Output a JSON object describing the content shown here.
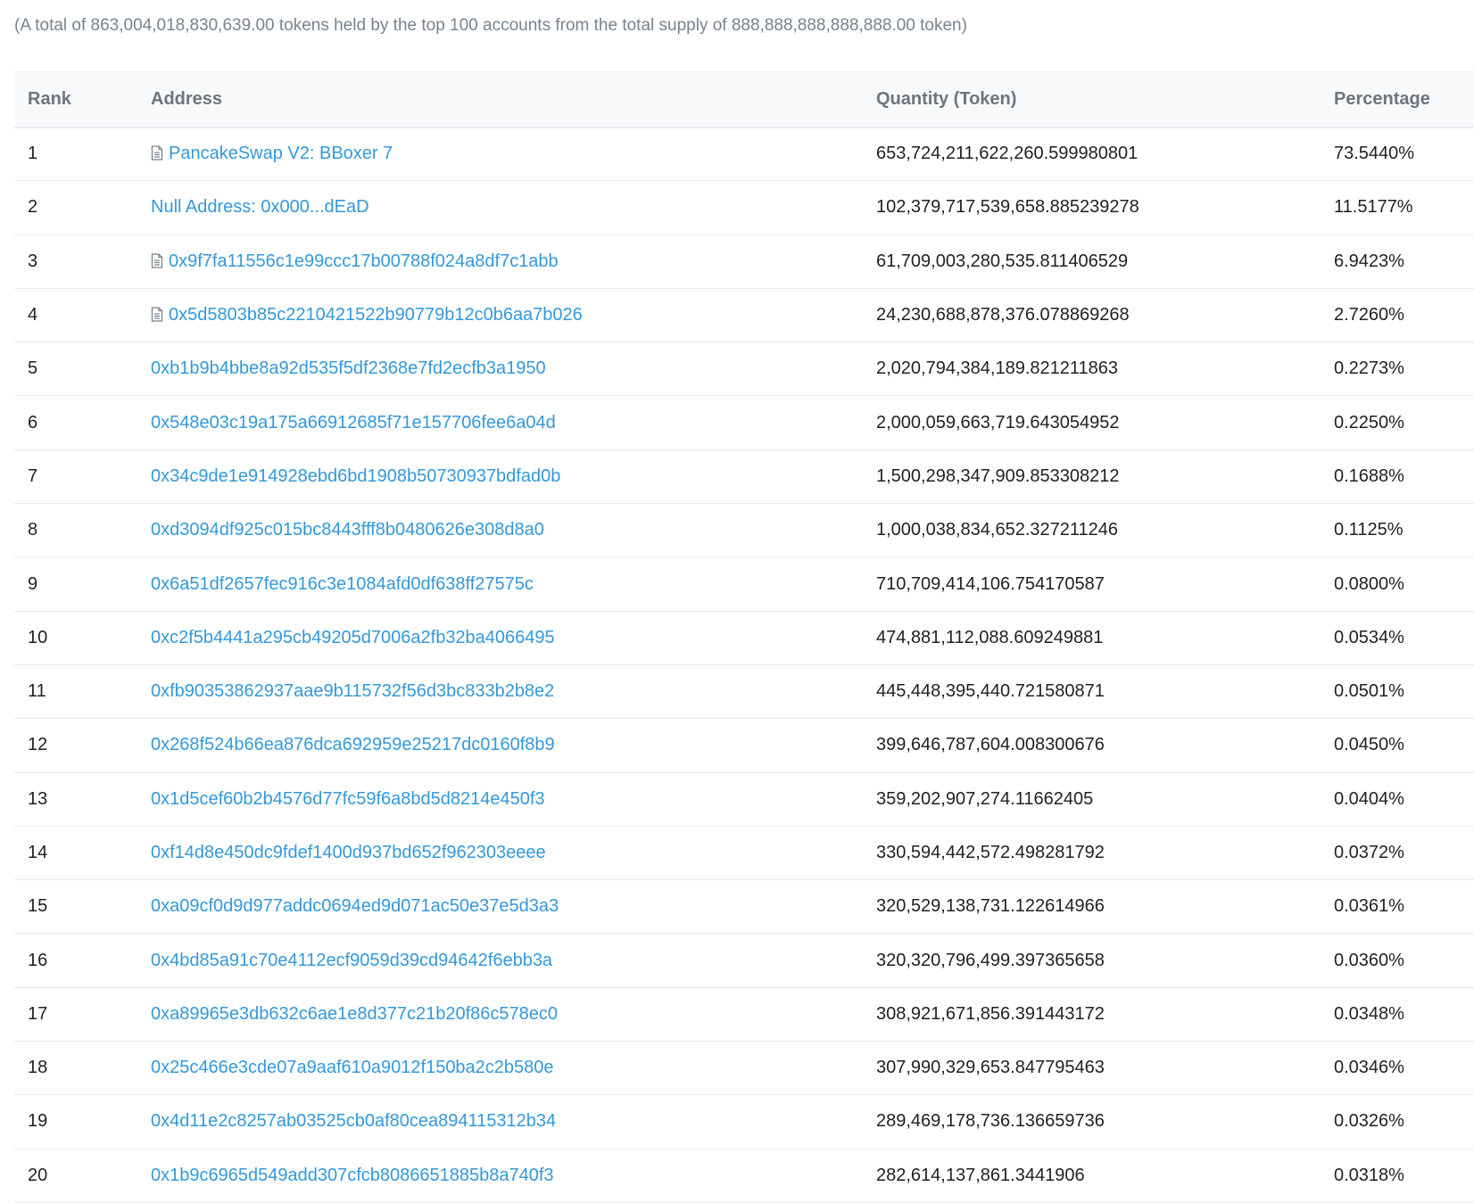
{
  "summary": "(A total of 863,004,018,830,639.00 tokens held by the top 100 accounts from the total supply of 888,888,888,888,888.00 token)",
  "table": {
    "headers": {
      "rank": "Rank",
      "address": "Address",
      "quantity": "Quantity (Token)",
      "percentage": "Percentage"
    },
    "rows": [
      {
        "rank": "1",
        "address": "PancakeSwap V2: BBoxer 7",
        "contract_icon": true,
        "quantity": "653,724,211,622,260.599980801",
        "percentage": "73.5440%"
      },
      {
        "rank": "2",
        "address": "Null Address: 0x000...dEaD",
        "contract_icon": false,
        "quantity": "102,379,717,539,658.885239278",
        "percentage": "11.5177%"
      },
      {
        "rank": "3",
        "address": "0x9f7fa11556c1e99ccc17b00788f024a8df7c1abb",
        "contract_icon": true,
        "quantity": "61,709,003,280,535.811406529",
        "percentage": "6.9423%"
      },
      {
        "rank": "4",
        "address": "0x5d5803b85c2210421522b90779b12c0b6aa7b026",
        "contract_icon": true,
        "quantity": "24,230,688,878,376.078869268",
        "percentage": "2.7260%"
      },
      {
        "rank": "5",
        "address": "0xb1b9b4bbe8a92d535f5df2368e7fd2ecfb3a1950",
        "contract_icon": false,
        "quantity": "2,020,794,384,189.821211863",
        "percentage": "0.2273%"
      },
      {
        "rank": "6",
        "address": "0x548e03c19a175a66912685f71e157706fee6a04d",
        "contract_icon": false,
        "quantity": "2,000,059,663,719.643054952",
        "percentage": "0.2250%"
      },
      {
        "rank": "7",
        "address": "0x34c9de1e914928ebd6bd1908b50730937bdfad0b",
        "contract_icon": false,
        "quantity": "1,500,298,347,909.853308212",
        "percentage": "0.1688%"
      },
      {
        "rank": "8",
        "address": "0xd3094df925c015bc8443fff8b0480626e308d8a0",
        "contract_icon": false,
        "quantity": "1,000,038,834,652.327211246",
        "percentage": "0.1125%"
      },
      {
        "rank": "9",
        "address": "0x6a51df2657fec916c3e1084afd0df638ff27575c",
        "contract_icon": false,
        "quantity": "710,709,414,106.754170587",
        "percentage": "0.0800%"
      },
      {
        "rank": "10",
        "address": "0xc2f5b4441a295cb49205d7006a2fb32ba4066495",
        "contract_icon": false,
        "quantity": "474,881,112,088.609249881",
        "percentage": "0.0534%"
      },
      {
        "rank": "11",
        "address": "0xfb90353862937aae9b115732f56d3bc833b2b8e2",
        "contract_icon": false,
        "quantity": "445,448,395,440.721580871",
        "percentage": "0.0501%"
      },
      {
        "rank": "12",
        "address": "0x268f524b66ea876dca692959e25217dc0160f8b9",
        "contract_icon": false,
        "quantity": "399,646,787,604.008300676",
        "percentage": "0.0450%"
      },
      {
        "rank": "13",
        "address": "0x1d5cef60b2b4576d77fc59f6a8bd5d8214e450f3",
        "contract_icon": false,
        "quantity": "359,202,907,274.11662405",
        "percentage": "0.0404%"
      },
      {
        "rank": "14",
        "address": "0xf14d8e450dc9fdef1400d937bd652f962303eeee",
        "contract_icon": false,
        "quantity": "330,594,442,572.498281792",
        "percentage": "0.0372%"
      },
      {
        "rank": "15",
        "address": "0xa09cf0d9d977addc0694ed9d071ac50e37e5d3a3",
        "contract_icon": false,
        "quantity": "320,529,138,731.122614966",
        "percentage": "0.0361%"
      },
      {
        "rank": "16",
        "address": "0x4bd85a91c70e4112ecf9059d39cd94642f6ebb3a",
        "contract_icon": false,
        "quantity": "320,320,796,499.397365658",
        "percentage": "0.0360%"
      },
      {
        "rank": "17",
        "address": "0xa89965e3db632c6ae1e8d377c21b20f86c578ec0",
        "contract_icon": false,
        "quantity": "308,921,671,856.391443172",
        "percentage": "0.0348%"
      },
      {
        "rank": "18",
        "address": "0x25c466e3cde07a9aaf610a9012f150ba2c2b580e",
        "contract_icon": false,
        "quantity": "307,990,329,653.847795463",
        "percentage": "0.0346%"
      },
      {
        "rank": "19",
        "address": "0x4d11e2c8257ab03525cb0af80cea894115312b34",
        "contract_icon": false,
        "quantity": "289,469,178,736.136659736",
        "percentage": "0.0326%"
      },
      {
        "rank": "20",
        "address": "0x1b9c6965d549add307cfcb8086651885b8a740f3",
        "contract_icon": false,
        "quantity": "282,614,137,861.3441906",
        "percentage": "0.0318%"
      }
    ]
  },
  "colors": {
    "link": "#3498db",
    "muted_text": "#77838f",
    "header_text": "#6c757e",
    "header_bg": "#f8f9fa",
    "row_border": "#e7eaf3",
    "icon": "#77838f"
  },
  "icons": {
    "contract": "file-document-icon"
  }
}
